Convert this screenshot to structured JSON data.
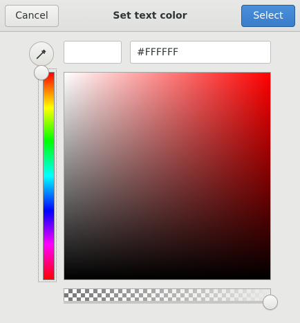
{
  "dialog": {
    "title": "Set text color",
    "cancel_label": "Cancel",
    "select_label": "Select"
  },
  "editor": {
    "hex_value": "#FFFFFF",
    "swatch_color": "#FFFFFF",
    "hue_icon": "eyedropper-icon",
    "alpha_fraction": 1.0
  },
  "colors": {
    "accent": "#3A7DC9",
    "background": "#E8E8E7"
  }
}
